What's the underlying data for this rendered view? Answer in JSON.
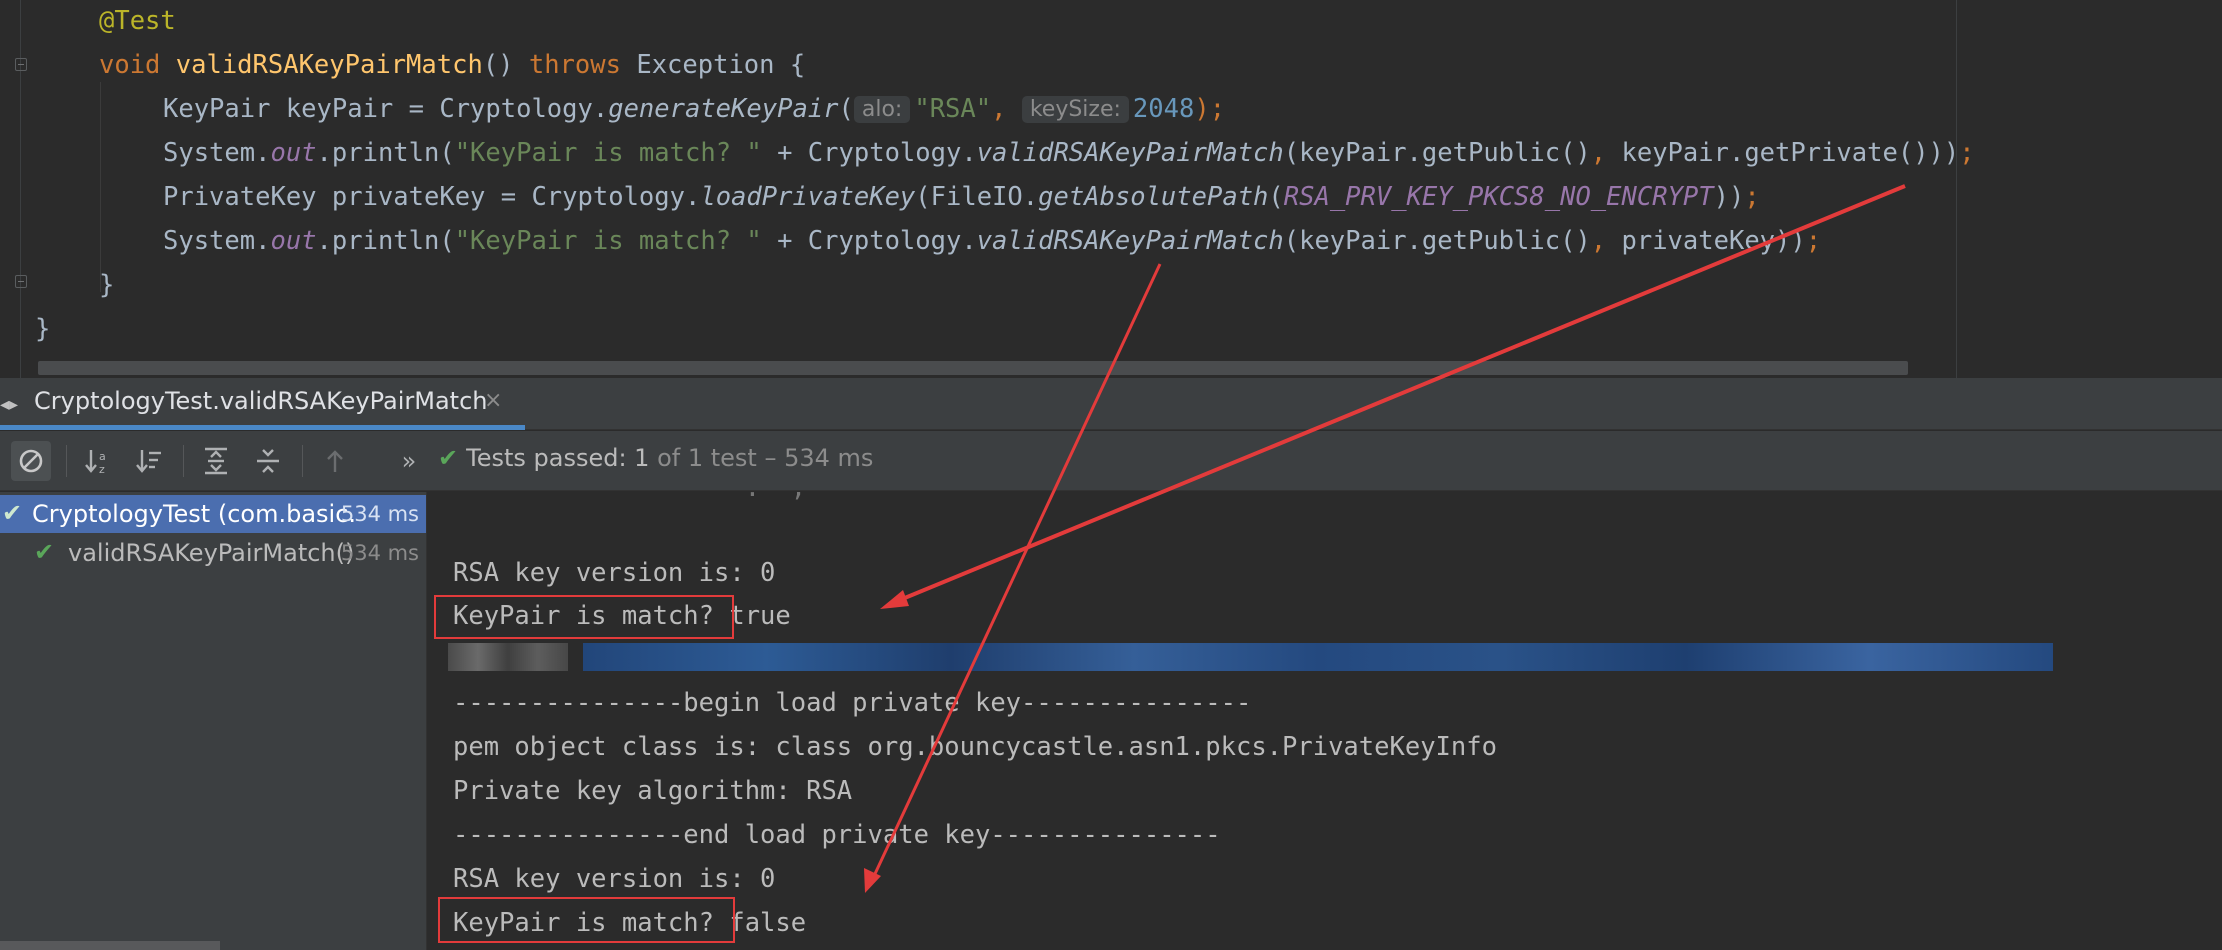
{
  "editor": {
    "lines": [
      {
        "tokens": [
          {
            "t": "@Test",
            "c": "ann"
          }
        ]
      },
      {
        "tokens": [
          {
            "t": "void ",
            "c": "kw"
          },
          {
            "t": "validRSAKeyPairMatch",
            "c": "fn"
          },
          {
            "t": "() "
          },
          {
            "t": "throws ",
            "c": "kw"
          },
          {
            "t": "Exception {"
          }
        ]
      },
      {
        "tokens": [
          {
            "t": "KeyPair keyPair = Cryptology."
          },
          {
            "t": "generateKeyPair",
            "c": "ital"
          },
          {
            "t": "("
          },
          {
            "t": "alo:",
            "c": "hint"
          },
          {
            "t": "\"RSA\"",
            "c": "str"
          },
          {
            "t": ", ",
            "c": "kw"
          },
          {
            "t": "keySize:",
            "c": "hint"
          },
          {
            "t": "2048",
            "c": "num"
          },
          {
            "t": ");",
            "c": "kw"
          }
        ]
      },
      {
        "tokens": [
          {
            "t": "System."
          },
          {
            "t": "out",
            "c": "fld"
          },
          {
            "t": ".println("
          },
          {
            "t": "\"KeyPair is match? \"",
            "c": "str"
          },
          {
            "t": " + Cryptology."
          },
          {
            "t": "validRSAKeyPairMatch",
            "c": "ital"
          },
          {
            "t": "(keyPair.getPublic()"
          },
          {
            "t": ", ",
            "c": "kw"
          },
          {
            "t": "keyPair.getPrivate()))"
          },
          {
            "t": ";",
            "c": "kw"
          }
        ]
      },
      {
        "tokens": [
          {
            "t": "PrivateKey privateKey = Cryptology."
          },
          {
            "t": "loadPrivateKey",
            "c": "ital"
          },
          {
            "t": "(FileIO."
          },
          {
            "t": "getAbsolutePath",
            "c": "ital"
          },
          {
            "t": "("
          },
          {
            "t": "RSA_PRV_KEY_PKCS8_NO_ENCRYPT",
            "c": "fld"
          },
          {
            "t": "))"
          },
          {
            "t": ";",
            "c": "kw"
          }
        ]
      },
      {
        "tokens": [
          {
            "t": "System."
          },
          {
            "t": "out",
            "c": "fld"
          },
          {
            "t": ".println("
          },
          {
            "t": "\"KeyPair is match? \"",
            "c": "str"
          },
          {
            "t": " + Cryptology."
          },
          {
            "t": "validRSAKeyPairMatch",
            "c": "ital"
          },
          {
            "t": "(keyPair.getPublic()"
          },
          {
            "t": ", ",
            "c": "kw"
          },
          {
            "t": "privateKey))"
          },
          {
            "t": ";",
            "c": "kw"
          }
        ]
      },
      {
        "tokens": [
          {
            "t": "}"
          }
        ]
      },
      {
        "tokens": [
          {
            "t": "}"
          }
        ]
      }
    ]
  },
  "run_tab": {
    "title": "CryptologyTest.validRSAKeyPairMatch",
    "close_glyph": "×"
  },
  "toolbar": {
    "status_prefix": "Tests passed: ",
    "status_count": "1",
    "status_suffix": " of 1 test – 534 ms",
    "more_glyph": "»"
  },
  "test_tree": {
    "items": [
      {
        "label": "CryptologyTest (com.basic.",
        "duration": "534 ms"
      },
      {
        "label": "validRSAKeyPairMatch()",
        "duration": "534 ms"
      }
    ]
  },
  "console": {
    "lines": [
      "RSA key version is: 0",
      "KeyPair is match? true",
      "---------------begin load private key---------------",
      "pem object class is: class org.bouncycastle.asn1.pkcs.PrivateKeyInfo",
      "Private key algorithm: RSA",
      "---------------end load private key---------------",
      "RSA key version is: 0",
      "KeyPair is match? false"
    ]
  },
  "colors": {
    "annotation_red": "#e33b3b",
    "selection_blue": "#4b6eaf",
    "pass_green": "#5aa65a"
  },
  "icons": [
    "sort-alpha-icon",
    "sort-duration-icon",
    "expand-all-icon",
    "collapse-all-icon",
    "prev-failed-icon",
    "check-icon",
    "stop-icon"
  ]
}
